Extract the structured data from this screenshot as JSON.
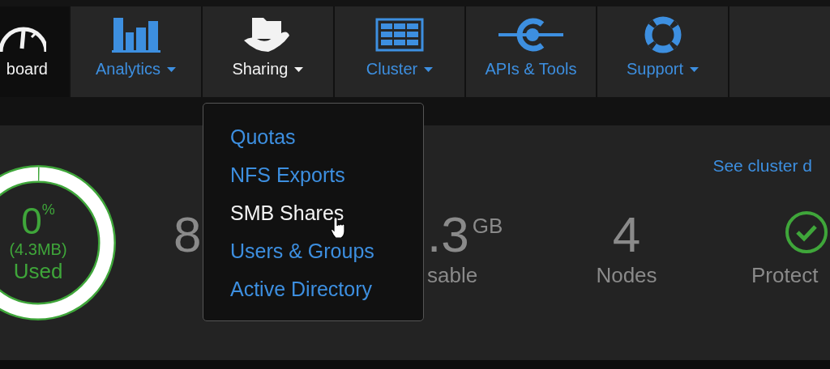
{
  "nav": {
    "tabs": [
      {
        "label": "board",
        "kind": "gauge",
        "dropdown": false,
        "selected": true,
        "open": false
      },
      {
        "label": "Analytics",
        "kind": "bars",
        "dropdown": true,
        "selected": false,
        "open": false
      },
      {
        "label": "Sharing",
        "kind": "share",
        "dropdown": true,
        "selected": false,
        "open": true
      },
      {
        "label": "Cluster",
        "kind": "grid",
        "dropdown": true,
        "selected": false,
        "open": false
      },
      {
        "label": "APIs & Tools",
        "kind": "plug",
        "dropdown": false,
        "selected": false,
        "open": false
      },
      {
        "label": "Support",
        "kind": "buoy",
        "dropdown": true,
        "selected": false,
        "open": false
      }
    ]
  },
  "dropdown_menu": {
    "items": [
      {
        "label": "Quotas",
        "hovered": false
      },
      {
        "label": "NFS Exports",
        "hovered": false
      },
      {
        "label": "SMB Shares",
        "hovered": true
      },
      {
        "label": "Users & Groups",
        "hovered": false
      },
      {
        "label": "Active Directory",
        "hovered": false
      }
    ]
  },
  "usage": {
    "level": 0,
    "percent": "0",
    "percent_sign": "%",
    "amount": "(4.3MB)",
    "label": "Used"
  },
  "link": "See cluster d",
  "stats": [
    {
      "kind": "number",
      "value": "8"
    },
    {
      "kind": "number",
      "value": ".3",
      "unit": "GB",
      "label": "sable"
    },
    {
      "kind": "number",
      "value": "4",
      "label": "Nodes"
    },
    {
      "kind": "status",
      "ok": true,
      "label": "Protect"
    }
  ]
}
